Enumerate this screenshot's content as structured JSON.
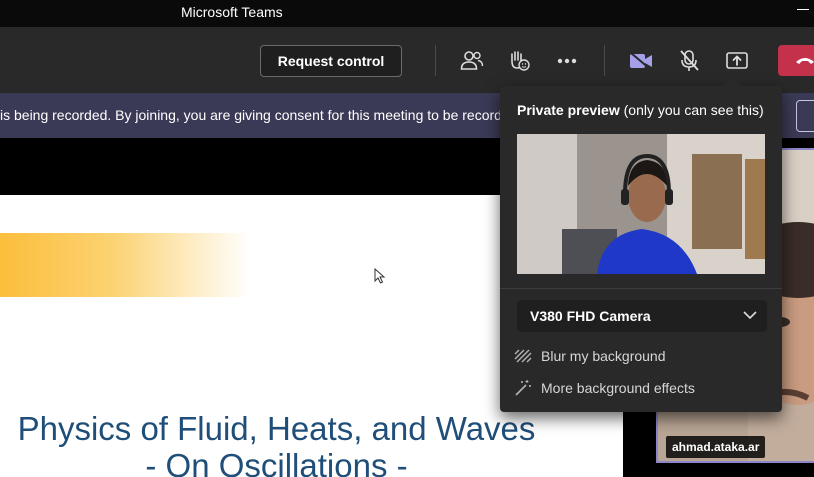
{
  "window": {
    "title": "Microsoft Teams"
  },
  "toolbar": {
    "request_control_label": "Request control",
    "icons": [
      "people-icon",
      "raise-hand-icon",
      "more-icon",
      "camera-icon",
      "mic-off-icon",
      "share-icon",
      "hang-up-icon"
    ],
    "accent": "#a6a0ea",
    "hangup_color": "#c4314b"
  },
  "banner": {
    "text": "is being recorded. By joining, you are giving consent for this meeting to be recorded."
  },
  "slide": {
    "title_line1": "Physics of Fluid, Heats, and Waves",
    "title_line2": "- On Oscillations -",
    "title_color": "#1f4e79",
    "bar_color": "#fbbe3c"
  },
  "participant": {
    "name": "ahmad.ataka.ar"
  },
  "preview_popup": {
    "heading_bold": "Private preview",
    "heading_note": " (only you can see this)",
    "camera": "V380 FHD Camera",
    "effects": [
      {
        "label": "Blur my background",
        "icon": "blur-icon"
      },
      {
        "label": "More background effects",
        "icon": "magic-wand-icon"
      }
    ]
  }
}
